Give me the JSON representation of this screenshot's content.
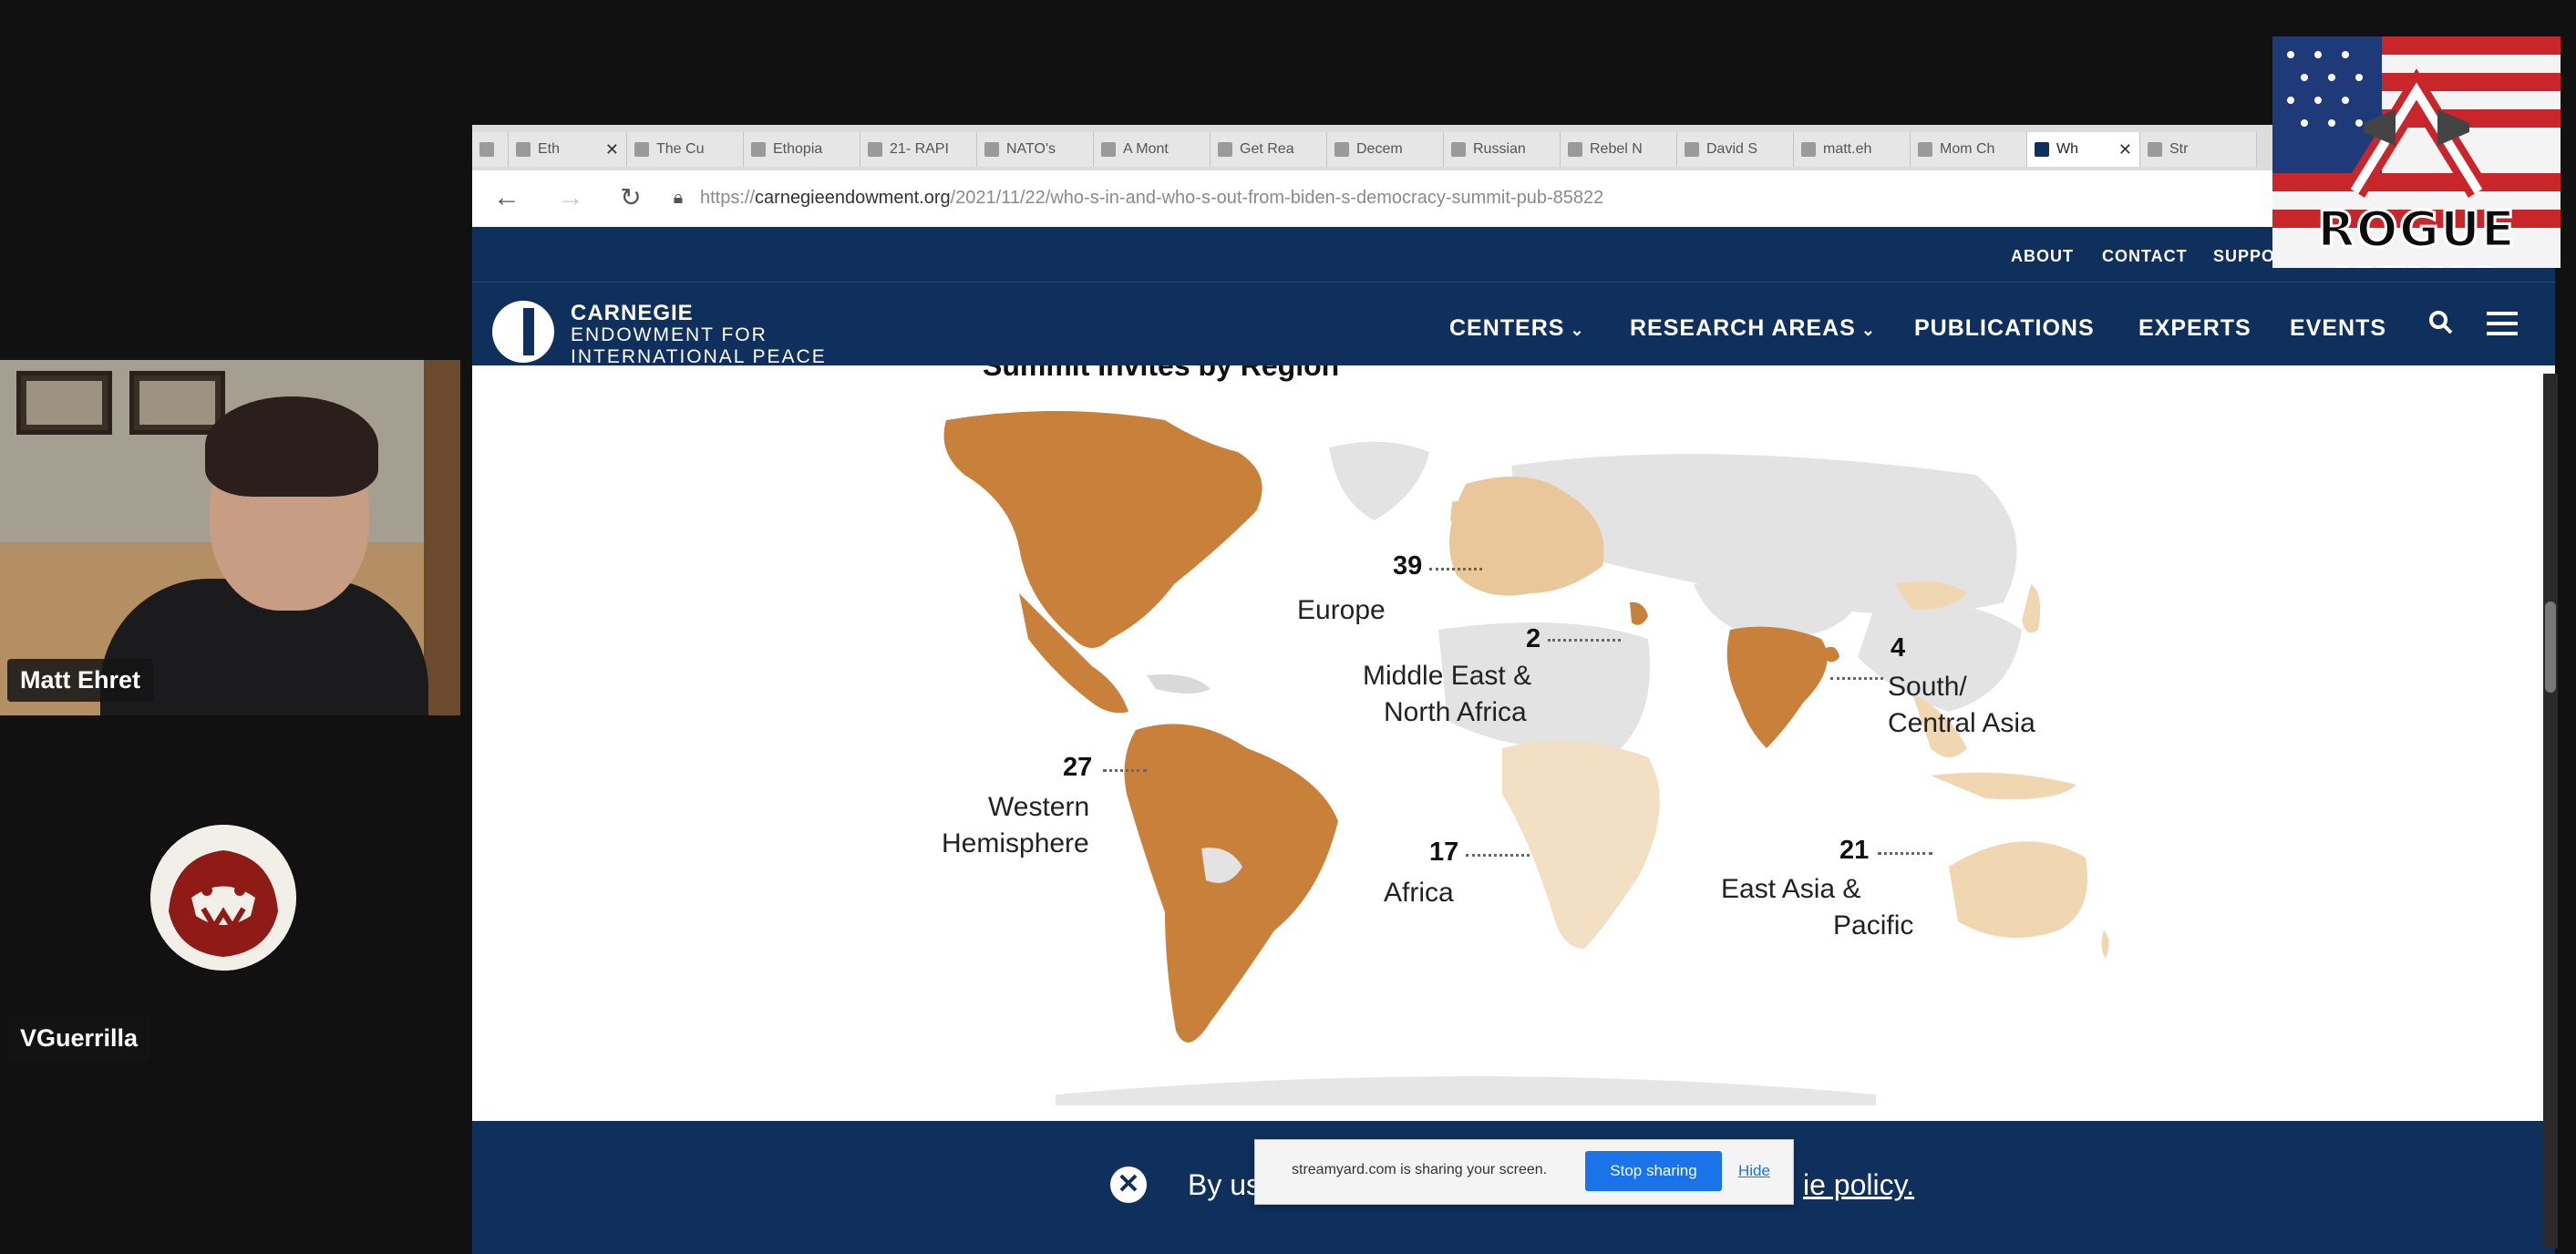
{
  "stream": {
    "participants": [
      {
        "name": "Matt Ehret"
      },
      {
        "name": "VGuerrilla"
      }
    ],
    "overlay_logo": "ROGUE NEWS"
  },
  "browser": {
    "tabs": [
      {
        "label": "Eth",
        "icon": "doc-icon"
      },
      {
        "label": "The Cu",
        "icon": "doc-icon"
      },
      {
        "label": "Ethopia",
        "icon": "doc-icon"
      },
      {
        "label": "21- RAPI",
        "icon": "doc-icon"
      },
      {
        "label": "NATO's",
        "icon": "doc-icon"
      },
      {
        "label": "A Mont",
        "icon": "doc-icon"
      },
      {
        "label": "Get Rea",
        "icon": "doc-icon"
      },
      {
        "label": "Decem",
        "icon": "doc-icon"
      },
      {
        "label": "Russian",
        "icon": "doc-icon"
      },
      {
        "label": "Rebel N",
        "icon": "doc-icon"
      },
      {
        "label": "David S",
        "icon": "doc-icon"
      },
      {
        "label": "matt.eh",
        "icon": "doc-icon"
      },
      {
        "label": "Mom Ch",
        "icon": "doc-icon"
      },
      {
        "label": "Wh",
        "icon": "carnegie-icon",
        "active": true
      },
      {
        "label": "Str",
        "icon": "doc-icon"
      }
    ],
    "url_prefix": "https://",
    "url_domain": "carnegieendowment.org",
    "url_path": "/2021/11/22/who-s-in-and-who-s-out-from-biden-s-democracy-summit-pub-85822"
  },
  "site": {
    "utility_links": [
      "ABOUT",
      "CONTACT",
      "SUPPO"
    ],
    "logo_line1": "CARNEGIE",
    "logo_line2": "ENDOWMENT FOR",
    "logo_line3": "INTERNATIONAL PEACE",
    "nav": [
      "CENTERS",
      "RESEARCH AREAS",
      "PUBLICATIONS",
      "EXPERTS",
      "EVENTS"
    ],
    "accent_color": "#0f2f5c"
  },
  "map": {
    "heading": "Summit Invites by Region",
    "regions": [
      {
        "name": "Europe",
        "count": "39",
        "color": "#eac79a"
      },
      {
        "name": "Middle East & North Africa",
        "line1": "Middle East &",
        "line2": "North Africa",
        "count": "2",
        "color": "#c9803a"
      },
      {
        "name": "South/ Central Asia",
        "line1": "South/",
        "line2": "Central Asia",
        "count": "4",
        "color": "#c9803a"
      },
      {
        "name": "Western Hemisphere",
        "line1": "Western",
        "line2": "Hemisphere",
        "count": "27",
        "color": "#c9803a"
      },
      {
        "name": "Africa",
        "count": "17",
        "color": "#f3dfc4"
      },
      {
        "name": "East Asia & Pacific",
        "line1": "East Asia &",
        "line2": "Pacific",
        "count": "21",
        "color": "#f1d6b2"
      }
    ]
  },
  "cookie": {
    "text": "By us",
    "link": "ie policy."
  },
  "share_popup": {
    "message": "streamyard.com is sharing your screen.",
    "stop": "Stop sharing",
    "hide": "Hide"
  }
}
